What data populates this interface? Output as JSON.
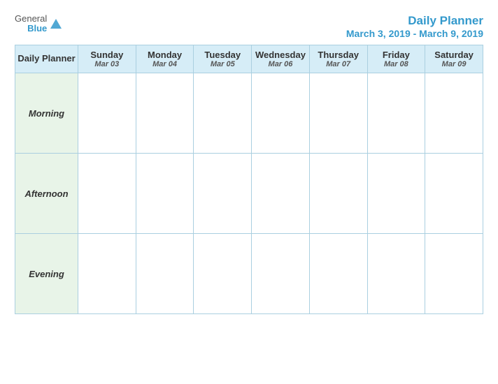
{
  "header": {
    "logo": {
      "general": "General",
      "blue": "Blue"
    },
    "title": "Daily Planner",
    "date_range": "March 3, 2019 - March 9, 2019"
  },
  "table": {
    "header_label": "Daily Planner",
    "days": [
      {
        "name": "Sunday",
        "date": "Mar 03"
      },
      {
        "name": "Monday",
        "date": "Mar 04"
      },
      {
        "name": "Tuesday",
        "date": "Mar 05"
      },
      {
        "name": "Wednesday",
        "date": "Mar 06"
      },
      {
        "name": "Thursday",
        "date": "Mar 07"
      },
      {
        "name": "Friday",
        "date": "Mar 08"
      },
      {
        "name": "Saturday",
        "date": "Mar 09"
      }
    ],
    "rows": [
      {
        "label": "Morning"
      },
      {
        "label": "Afternoon"
      },
      {
        "label": "Evening"
      }
    ]
  }
}
